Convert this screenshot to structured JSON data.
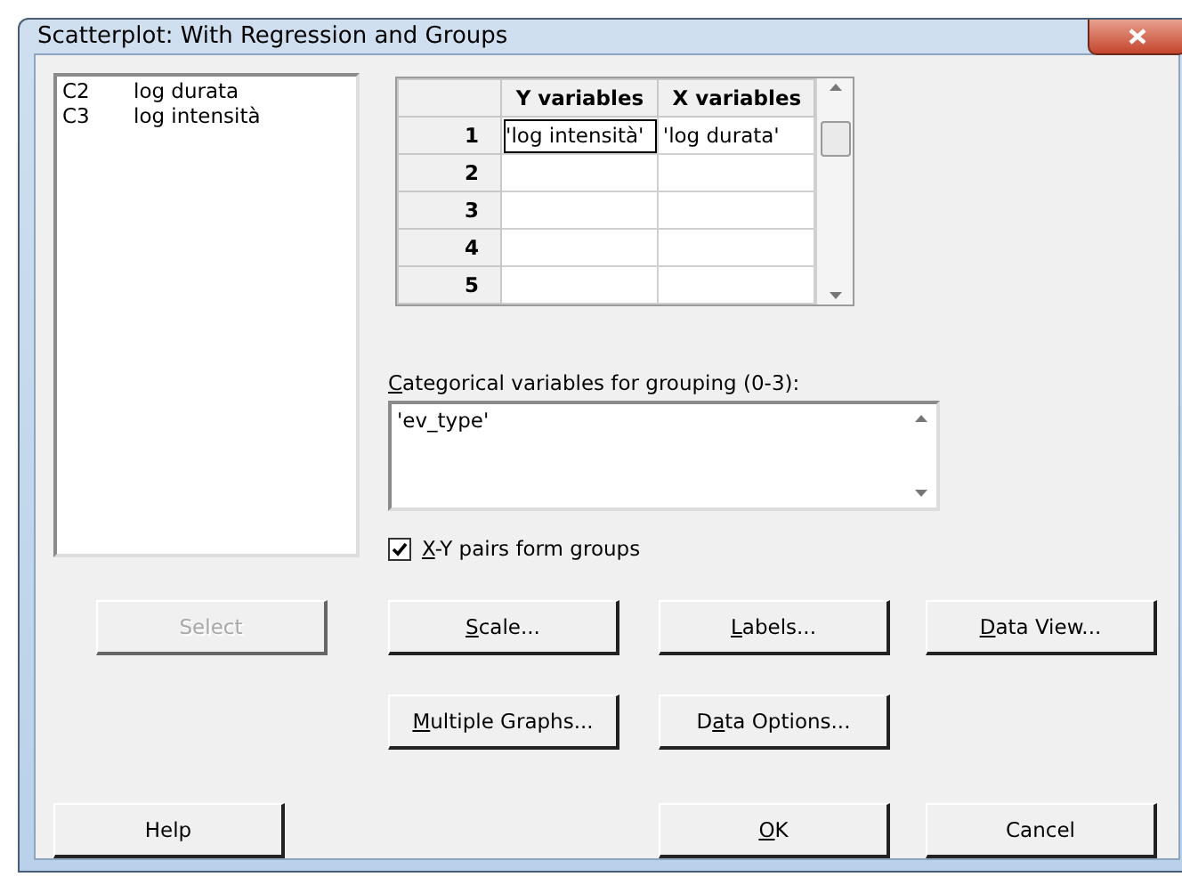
{
  "window": {
    "title": "Scatterplot: With Regression and Groups"
  },
  "variables": [
    {
      "id": "C2",
      "name": "log durata"
    },
    {
      "id": "C3",
      "name": "log intensità"
    }
  ],
  "table": {
    "columns": [
      "Y variables",
      "X variables"
    ],
    "rows": [
      {
        "number": "1",
        "cells": [
          "'log intensità'",
          "'log durata'"
        ]
      },
      {
        "number": "2",
        "cells": []
      },
      {
        "number": "3",
        "cells": []
      },
      {
        "number": "4",
        "cells": []
      },
      {
        "number": "5",
        "cells": []
      }
    ]
  },
  "grouping": {
    "label": {
      "key": "C",
      "post": "ategorical variables for grouping (0-3):"
    },
    "value": "'ev_type'"
  },
  "pairs_checkbox": {
    "label": {
      "key": "X",
      "post": "-Y pairs form groups"
    },
    "checked": true
  },
  "button_rows": [
    [
      {
        "label": {
          "post": "Select"
        },
        "disabled": true
      },
      {
        "label": {
          "key": "S",
          "post": "cale..."
        },
        "disabled": false
      },
      {
        "label": {
          "key": "L",
          "post": "abels..."
        },
        "disabled": false
      },
      {
        "label": {
          "key": "D",
          "post": "ata View..."
        },
        "disabled": false
      }
    ],
    [
      null,
      {
        "label": {
          "key": "M",
          "post": "ultiple Graphs..."
        },
        "disabled": false
      },
      {
        "label": {
          "pre": "D",
          "key": "a",
          "post": "ta Options..."
        },
        "disabled": false
      },
      null
    ],
    [
      {
        "label": {
          "pre": "Help"
        },
        "disabled": false
      },
      null,
      {
        "label": {
          "key": "O",
          "post": "K"
        },
        "disabled": false
      },
      {
        "label": {
          "post": "Cancel"
        },
        "disabled": false
      }
    ]
  ]
}
